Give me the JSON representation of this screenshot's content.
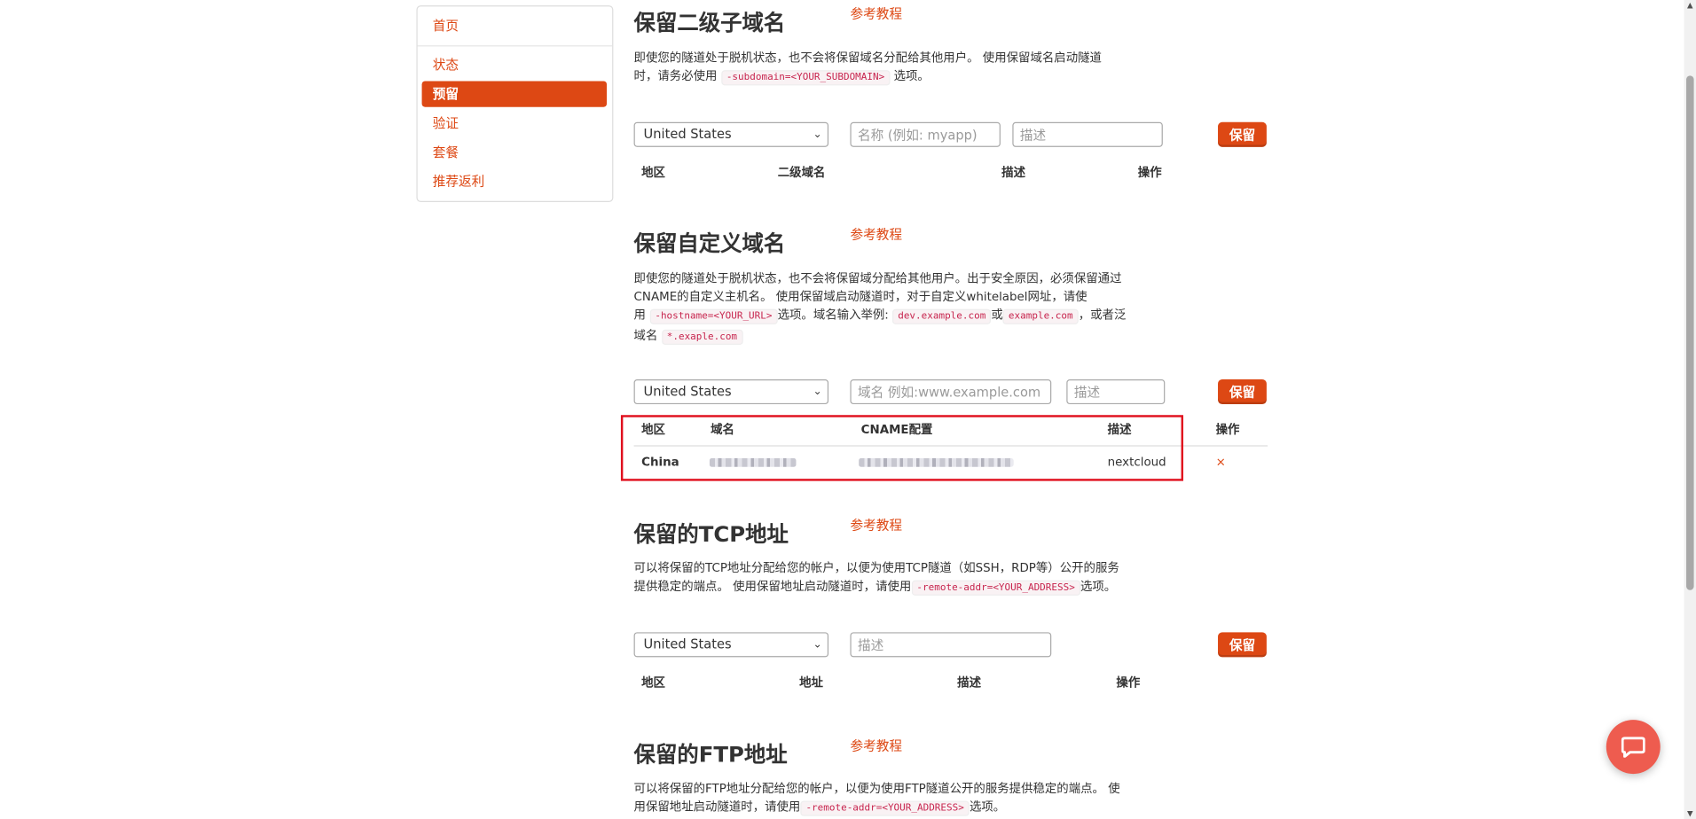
{
  "sidebar": {
    "items": [
      {
        "label": "首页",
        "active": false
      },
      {
        "label": "状态",
        "active": false
      },
      {
        "label": "预留",
        "active": true
      },
      {
        "label": "验证",
        "active": false
      },
      {
        "label": "套餐",
        "active": false
      },
      {
        "label": "推荐返利",
        "active": false
      }
    ]
  },
  "tutorial_label": "参考教程",
  "reserve_button_label": "保留",
  "region_default": "United States",
  "subdomain": {
    "title": "保留二级子域名",
    "desc_1": "即使您的隧道处于脱机状态，也不会将保留域名分配给其他用户。 使用保留域名启动隧道",
    "desc_2a": "时，请务必使用",
    "desc_code": "-subdomain=<YOUR_SUBDOMAIN>",
    "desc_2b": "选项。",
    "name_placeholder": "名称 (例如: myapp)",
    "desc_placeholder": "描述",
    "columns": [
      "地区",
      "二级域名",
      "描述",
      "操作"
    ]
  },
  "custom_domain": {
    "title": "保留自定义域名",
    "desc_1": "即使您的隧道处于脱机状态，也不会将保留域分配给其他用户。出于安全原因，必须保留通过",
    "desc_2": "CNAME的自定义主机名。 使用保留域启动隧道时，对于自定义whitelabel网址，请使",
    "desc_3a": "用",
    "desc_code1": "-hostname=<YOUR_URL>",
    "desc_3b": "选项。域名输入举例:",
    "desc_code2": "dev.example.com",
    "desc_3c": "或",
    "desc_code3": "example.com",
    "desc_3d": "，或者泛",
    "desc_4a": "域名",
    "desc_code4": "*.exaple.com",
    "domain_placeholder": "域名 例如:www.example.com",
    "desc_placeholder": "描述",
    "columns": [
      "地区",
      "域名",
      "CNAME配置",
      "描述",
      "操作"
    ],
    "rows": [
      {
        "region": "China",
        "description": "nextcloud",
        "delete": "×"
      }
    ]
  },
  "tcp": {
    "title": "保留的TCP地址",
    "desc_1": "可以将保留的TCP地址分配给您的帐户，以便为使用TCP隧道（如SSH，RDP等）公开的服务",
    "desc_2a": "提供稳定的端点。 使用保留地址启动隧道时，请使用",
    "desc_code": "-remote-addr=<YOUR_ADDRESS>",
    "desc_2b": "选项。",
    "desc_placeholder": "描述",
    "columns": [
      "地区",
      "地址",
      "描述",
      "操作"
    ]
  },
  "ftp": {
    "title": "保留的FTP地址",
    "desc_1": "可以将保留的FTP地址分配给您的帐户，以便为使用FTP隧道公开的服务提供稳定的端点。 使",
    "desc_2a": "用保留地址启动隧道时，请使用",
    "desc_code": "-remote-addr=<YOUR_ADDRESS>",
    "desc_2b": "选项。"
  },
  "colors": {
    "accent": "#dd4814",
    "highlight_box": "#e0101e",
    "chat": "#ee5c4f"
  }
}
